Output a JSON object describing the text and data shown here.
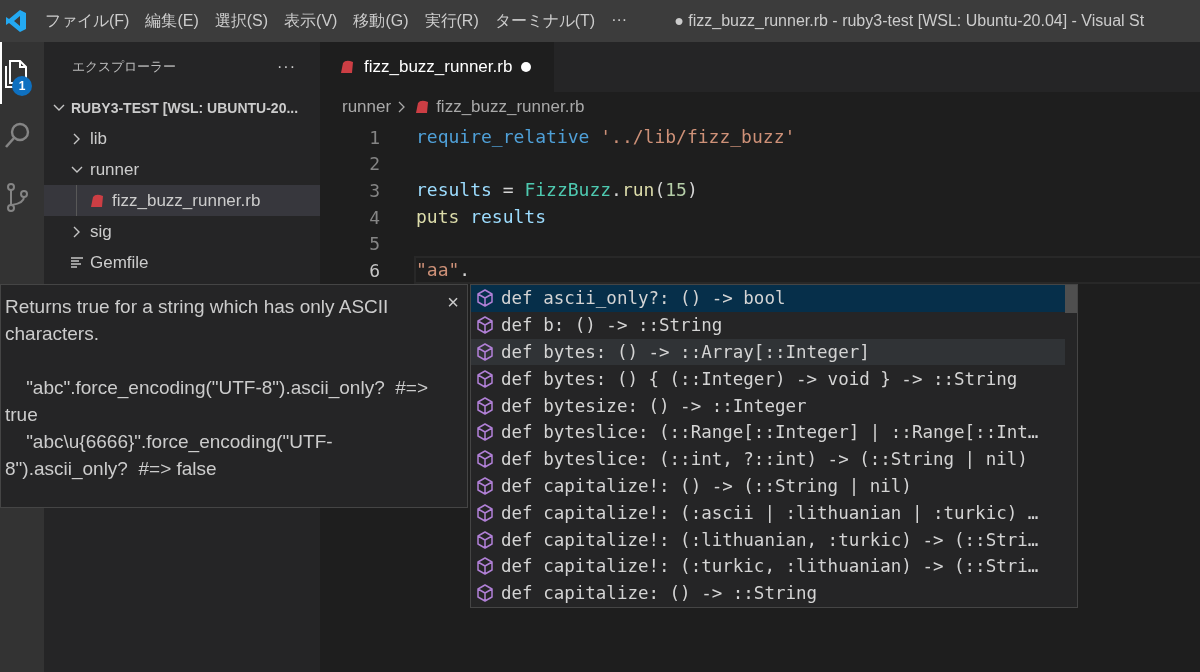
{
  "menu_bar": {
    "items": [
      "ファイル(F)",
      "編集(E)",
      "選択(S)",
      "表示(V)",
      "移動(G)",
      "実行(R)",
      "ターミナル(T)",
      "···"
    ]
  },
  "window": {
    "title": "● fizz_buzz_runner.rb - ruby3-test [WSL: Ubuntu-20.04] - Visual St"
  },
  "activity_bar": {
    "items": [
      {
        "kind": "files",
        "selected": true,
        "badge": "1"
      },
      {
        "kind": "search",
        "selected": false
      },
      {
        "kind": "source-control",
        "selected": false
      }
    ]
  },
  "sidebar": {
    "title": "エクスプローラー",
    "more": "···",
    "tree": [
      {
        "label": "RUBY3-TEST [WSL: UBUNTU-20...",
        "kind": "root",
        "expanded": true,
        "children": [
          {
            "label": "lib",
            "kind": "folder",
            "expanded": false
          },
          {
            "label": "runner",
            "kind": "folder",
            "expanded": true,
            "children": [
              {
                "label": "fizz_buzz_runner.rb",
                "kind": "ruby",
                "selected": true
              }
            ]
          },
          {
            "label": "sig",
            "kind": "folder",
            "expanded": false
          },
          {
            "label": "Gemfile",
            "kind": "file"
          }
        ]
      }
    ]
  },
  "tabs": [
    {
      "label": "fizz_buzz_runner.rb",
      "selected": true,
      "modified": true
    }
  ],
  "breadcrumb": [
    "runner",
    "fizz_buzz_runner.rb"
  ],
  "editor": {
    "lines": [
      {
        "number": "1",
        "tokens": [
          {
            "kind": "keyword",
            "text": "require_relative "
          },
          {
            "kind": "string",
            "text": "'../lib/fizz_buzz'"
          }
        ]
      },
      {
        "number": "2"
      },
      {
        "number": "3",
        "tokens": [
          {
            "kind": "variable",
            "text": "results"
          },
          {
            "kind": "plain",
            "text": " = "
          },
          {
            "kind": "class",
            "text": "FizzBuzz"
          },
          {
            "kind": "plain",
            "text": "."
          },
          {
            "kind": "function",
            "text": "run"
          },
          {
            "kind": "plain",
            "text": "("
          },
          {
            "kind": "number",
            "text": "15"
          },
          {
            "kind": "plain",
            "text": ")"
          }
        ]
      },
      {
        "number": "4",
        "tokens": [
          {
            "kind": "function",
            "text": "puts "
          },
          {
            "kind": "variable",
            "text": "results"
          }
        ]
      },
      {
        "number": "5"
      },
      {
        "number": "6",
        "current": true,
        "tokens": [
          {
            "kind": "string",
            "text": "\"aa\""
          },
          {
            "kind": "plain",
            "text": "."
          }
        ]
      }
    ]
  },
  "hover_doc": {
    "paragraphs": [
      "Returns true for a string which has only ASCII characters.",
      "    \"abc\".force_encoding(\"UTF-8\").ascii_only?  #=> true\n    \"abc\\u{6666}\".force_encoding(\"UTF-8\").ascii_only?  #=> false"
    ],
    "close": "×"
  },
  "suggestions": [
    {
      "label": "def ascii_only?: () -> bool",
      "selected": true
    },
    {
      "label": "def b: () -> ::String",
      "selected": false
    },
    {
      "label": "def bytes: () -> ::Array[::Integer]",
      "selected": false,
      "hovered": true
    },
    {
      "label": "def bytes: () { (::Integer) -> void } -> ::String",
      "selected": false
    },
    {
      "label": "def bytesize: () -> ::Integer",
      "selected": false
    },
    {
      "label": "def byteslice: (::Range[::Integer] | ::Range[::Int…",
      "selected": false
    },
    {
      "label": "def byteslice: (::int, ?::int) -> (::String | nil)",
      "selected": false
    },
    {
      "label": "def capitalize!: () -> (::String | nil)",
      "selected": false
    },
    {
      "label": "def capitalize!: (:ascii | :lithuanian | :turkic) …",
      "selected": false
    },
    {
      "label": "def capitalize!: (:lithuanian, :turkic) -> (::Stri…",
      "selected": false
    },
    {
      "label": "def capitalize!: (:turkic, :lithuanian) -> (::Stri…",
      "selected": false
    },
    {
      "label": "def capitalize: () -> ::String",
      "selected": false
    }
  ]
}
